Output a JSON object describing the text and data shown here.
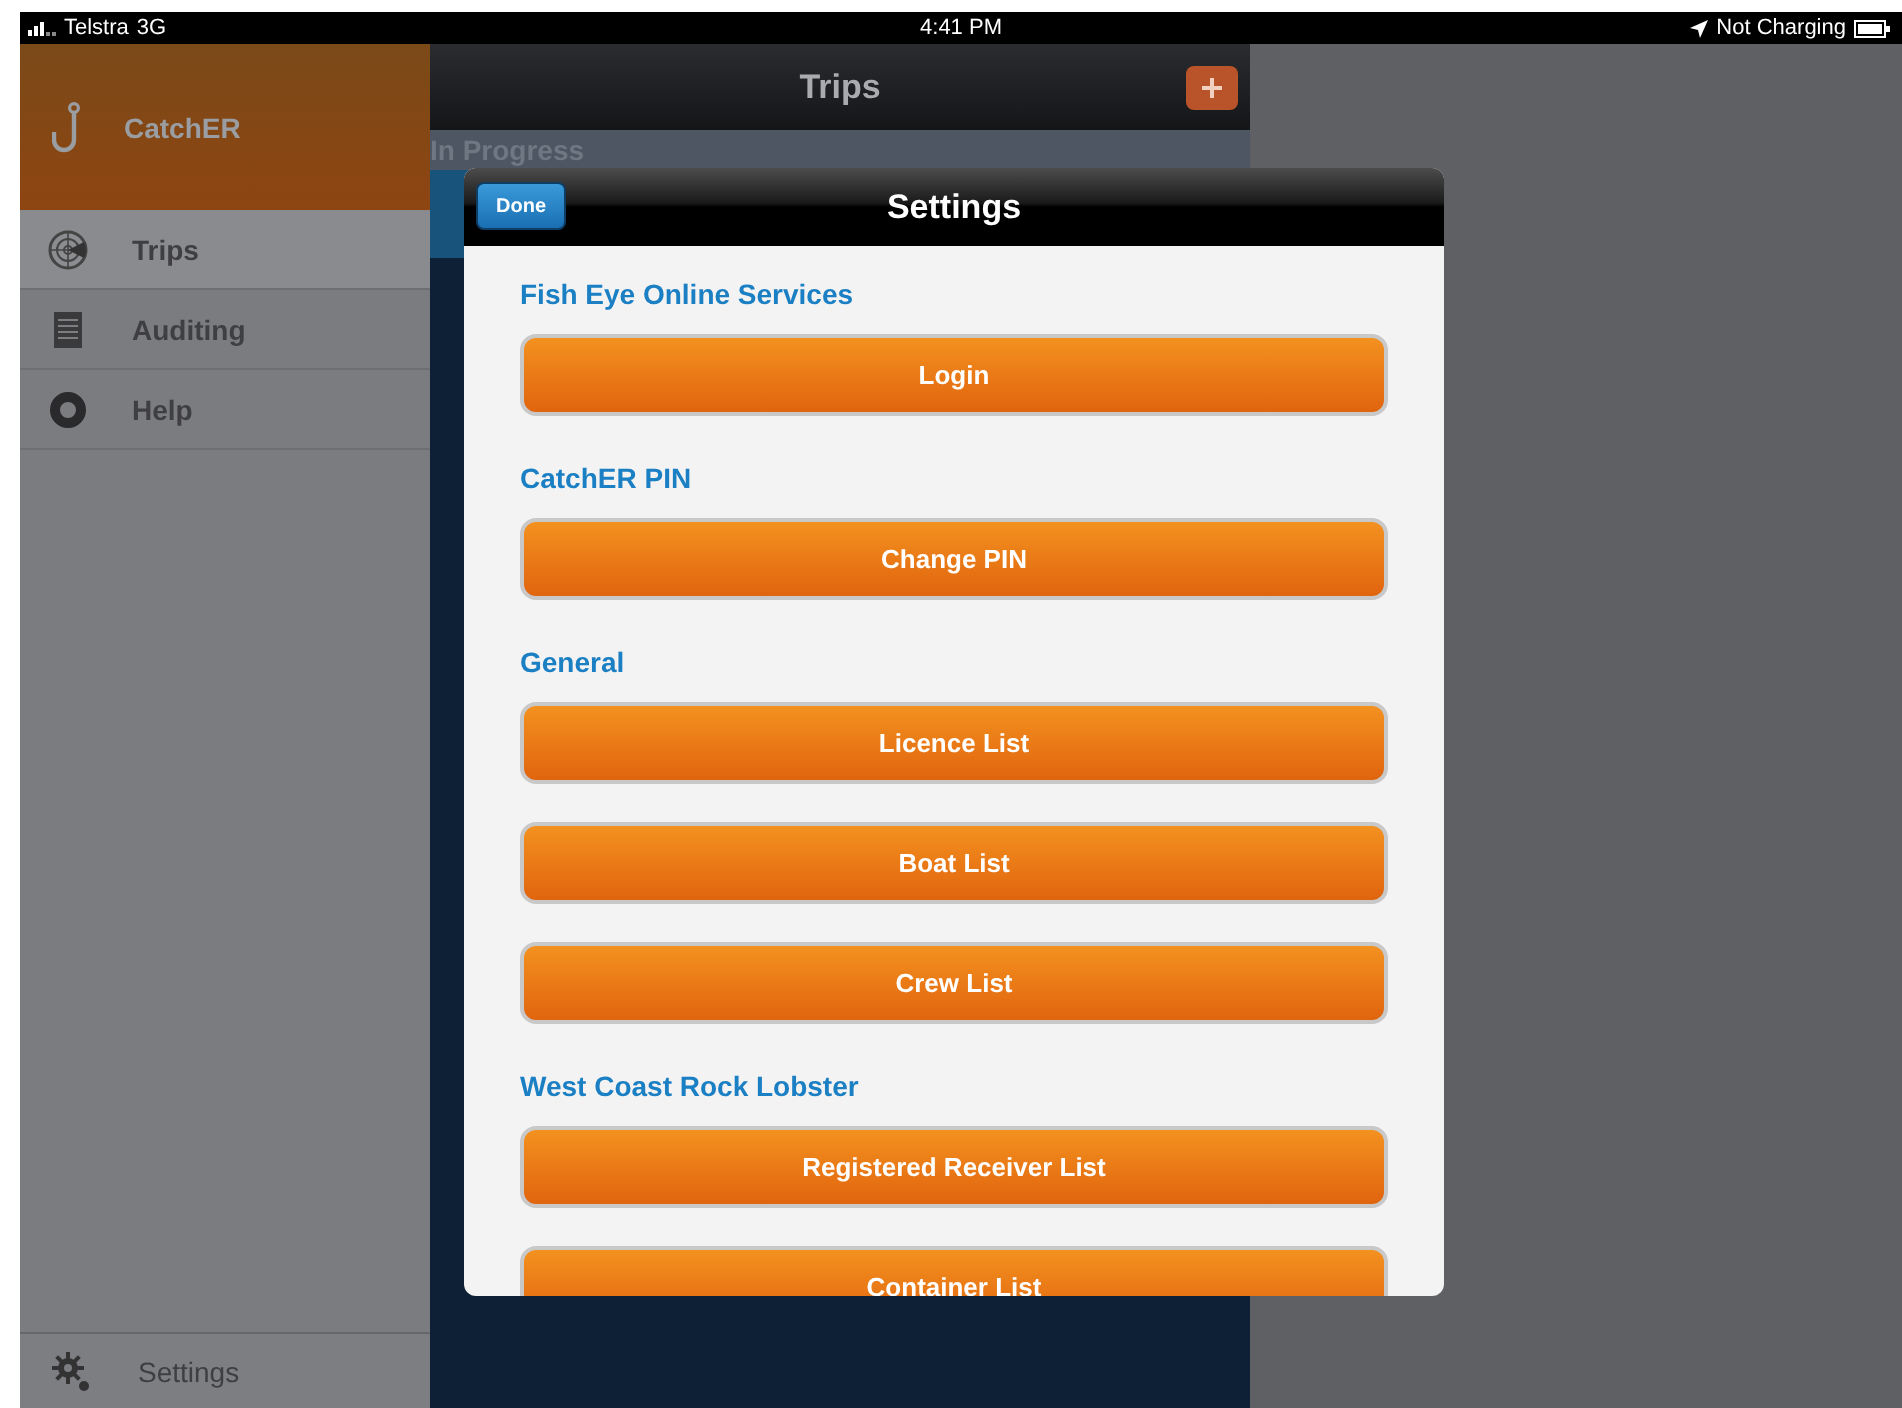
{
  "status_bar": {
    "carrier": "Telstra",
    "network": "3G",
    "time": "4:41 PM",
    "battery_status": "Not Charging"
  },
  "sidebar": {
    "app_name": "CatchER",
    "items": [
      {
        "label": "Trips",
        "kind": "radar",
        "selected": true
      },
      {
        "label": "Auditing",
        "kind": "document",
        "selected": false
      },
      {
        "label": "Help",
        "kind": "lifebuoy",
        "selected": false
      }
    ],
    "footer": {
      "label": "Settings"
    }
  },
  "trips_panel": {
    "title": "Trips",
    "section": "In Progress"
  },
  "settings_dialog": {
    "title": "Settings",
    "done_button": "Done",
    "sections": [
      {
        "heading": "Fish Eye Online Services",
        "buttons": [
          "Login"
        ]
      },
      {
        "heading": "CatchER PIN",
        "buttons": [
          "Change PIN"
        ]
      },
      {
        "heading": "General",
        "buttons": [
          "Licence List",
          "Boat List",
          "Crew List"
        ]
      },
      {
        "heading": "West Coast Rock Lobster",
        "buttons": [
          "Registered Receiver List",
          "Container List"
        ]
      }
    ]
  }
}
